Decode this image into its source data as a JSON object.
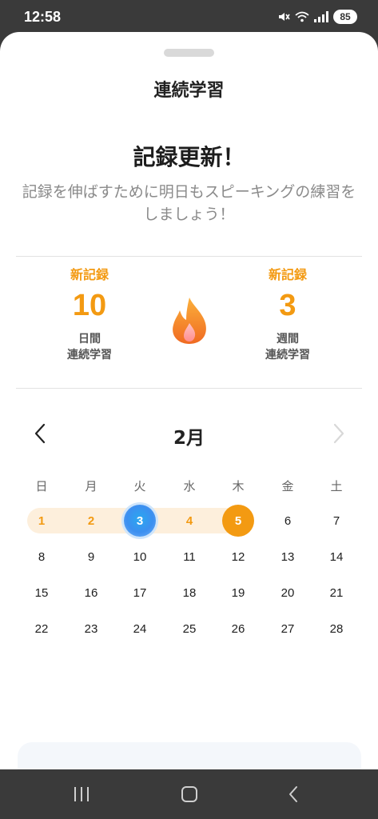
{
  "status_bar": {
    "time": "12:58",
    "battery": "85"
  },
  "sheet": {
    "title": "連続学習",
    "headline": "記録更新！",
    "subtext": "記録を伸ばすために明日もスピーキングの練習をしましょう！"
  },
  "stats": {
    "days": {
      "badge": "新記録",
      "value": "10",
      "label_line1": "日間",
      "label_line2": "連続学習"
    },
    "weeks": {
      "badge": "新記録",
      "value": "3",
      "label_line1": "週間",
      "label_line2": "連続学習"
    }
  },
  "calendar": {
    "month": "2月",
    "weekdays": [
      "日",
      "月",
      "火",
      "水",
      "木",
      "金",
      "土"
    ],
    "weeks": [
      [
        "1",
        "2",
        "3",
        "4",
        "5",
        "6",
        "7"
      ],
      [
        "8",
        "9",
        "10",
        "11",
        "12",
        "13",
        "14"
      ],
      [
        "15",
        "16",
        "17",
        "18",
        "19",
        "20",
        "21"
      ],
      [
        "22",
        "23",
        "24",
        "25",
        "26",
        "27",
        "28"
      ]
    ],
    "streak_days": [
      "1",
      "2",
      "3",
      "4",
      "5"
    ],
    "today": "3",
    "latest_day": "5"
  },
  "colors": {
    "accent_orange": "#f39a12",
    "streak_band": "#fdefdc",
    "today_blue": "#2f9bf0"
  },
  "icons": {
    "flame": "flame-icon",
    "prev": "chevron-left-icon",
    "next": "chevron-right-icon"
  }
}
